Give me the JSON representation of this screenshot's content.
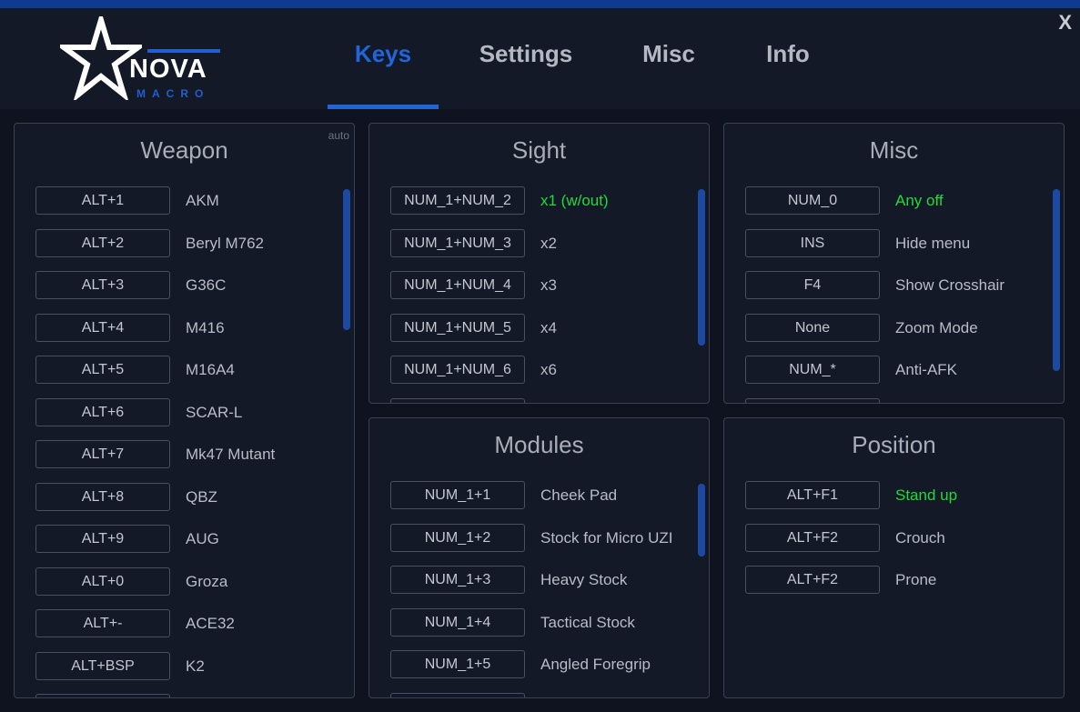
{
  "window": {
    "close_label": "X"
  },
  "logo": {
    "text_main": "NOVA",
    "text_sub": "MACRO"
  },
  "tabs": [
    {
      "label": "Keys",
      "active": true
    },
    {
      "label": "Settings"
    },
    {
      "label": "Misc"
    },
    {
      "label": "Info"
    }
  ],
  "colors": {
    "accent": "#1f66d8",
    "active_label": "#22d93b",
    "panel_border": "#3b4150"
  },
  "panels": {
    "weapon": {
      "title": "Weapon",
      "mode": "auto",
      "rows": [
        {
          "key": "ALT+1",
          "label": "AKM"
        },
        {
          "key": "ALT+2",
          "label": "Beryl M762"
        },
        {
          "key": "ALT+3",
          "label": "G36C"
        },
        {
          "key": "ALT+4",
          "label": "M416"
        },
        {
          "key": "ALT+5",
          "label": "M16A4"
        },
        {
          "key": "ALT+6",
          "label": "SCAR-L"
        },
        {
          "key": "ALT+7",
          "label": "Mk47 Mutant"
        },
        {
          "key": "ALT+8",
          "label": "QBZ"
        },
        {
          "key": "ALT+9",
          "label": "AUG"
        },
        {
          "key": "ALT+0",
          "label": "Groza"
        },
        {
          "key": "ALT+-",
          "label": "ACE32"
        },
        {
          "key": "ALT+BSP",
          "label": "K2"
        }
      ]
    },
    "sight": {
      "title": "Sight",
      "rows": [
        {
          "key": "NUM_1+NUM_2",
          "label": "x1 (w/out)",
          "active": true
        },
        {
          "key": "NUM_1+NUM_3",
          "label": "x2"
        },
        {
          "key": "NUM_1+NUM_4",
          "label": "x3"
        },
        {
          "key": "NUM_1+NUM_5",
          "label": "x4"
        },
        {
          "key": "NUM_1+NUM_6",
          "label": "x6"
        }
      ]
    },
    "misc": {
      "title": "Misc",
      "rows": [
        {
          "key": "NUM_0",
          "label": "Any off",
          "active": true
        },
        {
          "key": "INS",
          "label": "Hide menu"
        },
        {
          "key": "F4",
          "label": "Show Crosshair"
        },
        {
          "key": "None",
          "label": "Zoom Mode"
        },
        {
          "key": "NUM_*",
          "label": "Anti-AFK"
        }
      ]
    },
    "modules": {
      "title": "Modules",
      "rows": [
        {
          "key": "NUM_1+1",
          "label": "Cheek Pad"
        },
        {
          "key": "NUM_1+2",
          "label": "Stock for Micro UZI"
        },
        {
          "key": "NUM_1+3",
          "label": "Heavy Stock"
        },
        {
          "key": "NUM_1+4",
          "label": "Tactical Stock"
        },
        {
          "key": "NUM_1+5",
          "label": "Angled Foregrip"
        }
      ]
    },
    "position": {
      "title": "Position",
      "rows": [
        {
          "key": "ALT+F1",
          "label": "Stand up",
          "active": true
        },
        {
          "key": "ALT+F2",
          "label": "Crouch"
        },
        {
          "key": "ALT+F2",
          "label": "Prone"
        }
      ]
    }
  }
}
